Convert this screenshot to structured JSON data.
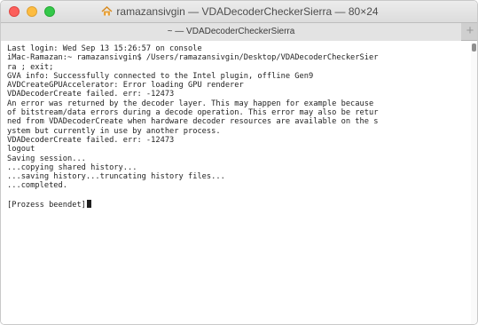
{
  "window": {
    "title": "ramazansivgin — VDADecoderCheckerSierra — 80×24",
    "home_icon": "home-folder-icon"
  },
  "tab": {
    "label": "~ — VDADecoderCheckerSierra",
    "add_label": "+"
  },
  "terminal": {
    "lines": [
      "Last login: Wed Sep 13 15:26:57 on console",
      "iMac-Ramazan:~ ramazansivgin$ /Users/ramazansivgin/Desktop/VDADecoderCheckerSier",
      "ra ; exit;",
      "GVA info: Successfully connected to the Intel plugin, offline Gen9",
      "AVDCreateGPUAccelerator: Error loading GPU renderer",
      "VDADecoderCreate failed. err: -12473",
      "An error was returned by the decoder layer. This may happen for example because",
      "of bitstream/data errors during a decode operation. This error may also be retur",
      "ned from VDADecoderCreate when hardware decoder resources are available on the s",
      "ystem but currently in use by another process.",
      "VDADecoderCreate failed. err: -12473",
      "logout",
      "Saving session...",
      "...copying shared history...",
      "...saving history...truncating history files...",
      "...completed.",
      "",
      "[Prozess beendet]"
    ]
  }
}
